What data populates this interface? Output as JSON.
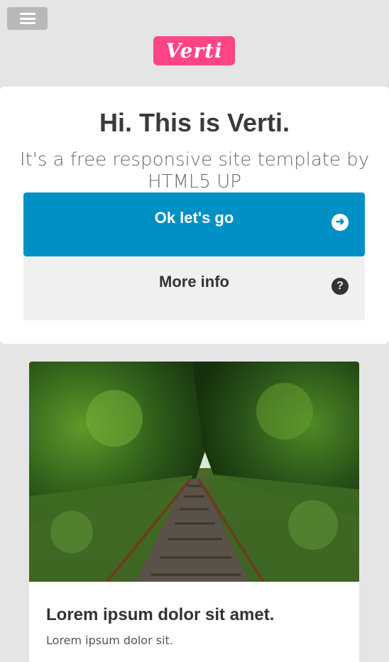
{
  "header": {
    "logo_text": "Verti",
    "logo_color": "#ff4486",
    "menu_icon": "hamburger-menu-icon"
  },
  "hero": {
    "title": "Hi. This is Verti.",
    "subtitle": "It's a free responsive site template by HTML5 UP",
    "primary_button": {
      "label": "Ok let's go",
      "icon": "arrow-right-circle-icon",
      "color": "#0090c5"
    },
    "secondary_button": {
      "label": "More info",
      "icon": "question-circle-icon",
      "color": "#f0f0f0"
    }
  },
  "feature_card": {
    "image": "railroad-tracks-forest-photo",
    "title": "Lorem ipsum dolor sit amet.",
    "text": "Lorem ipsum dolor sit."
  }
}
